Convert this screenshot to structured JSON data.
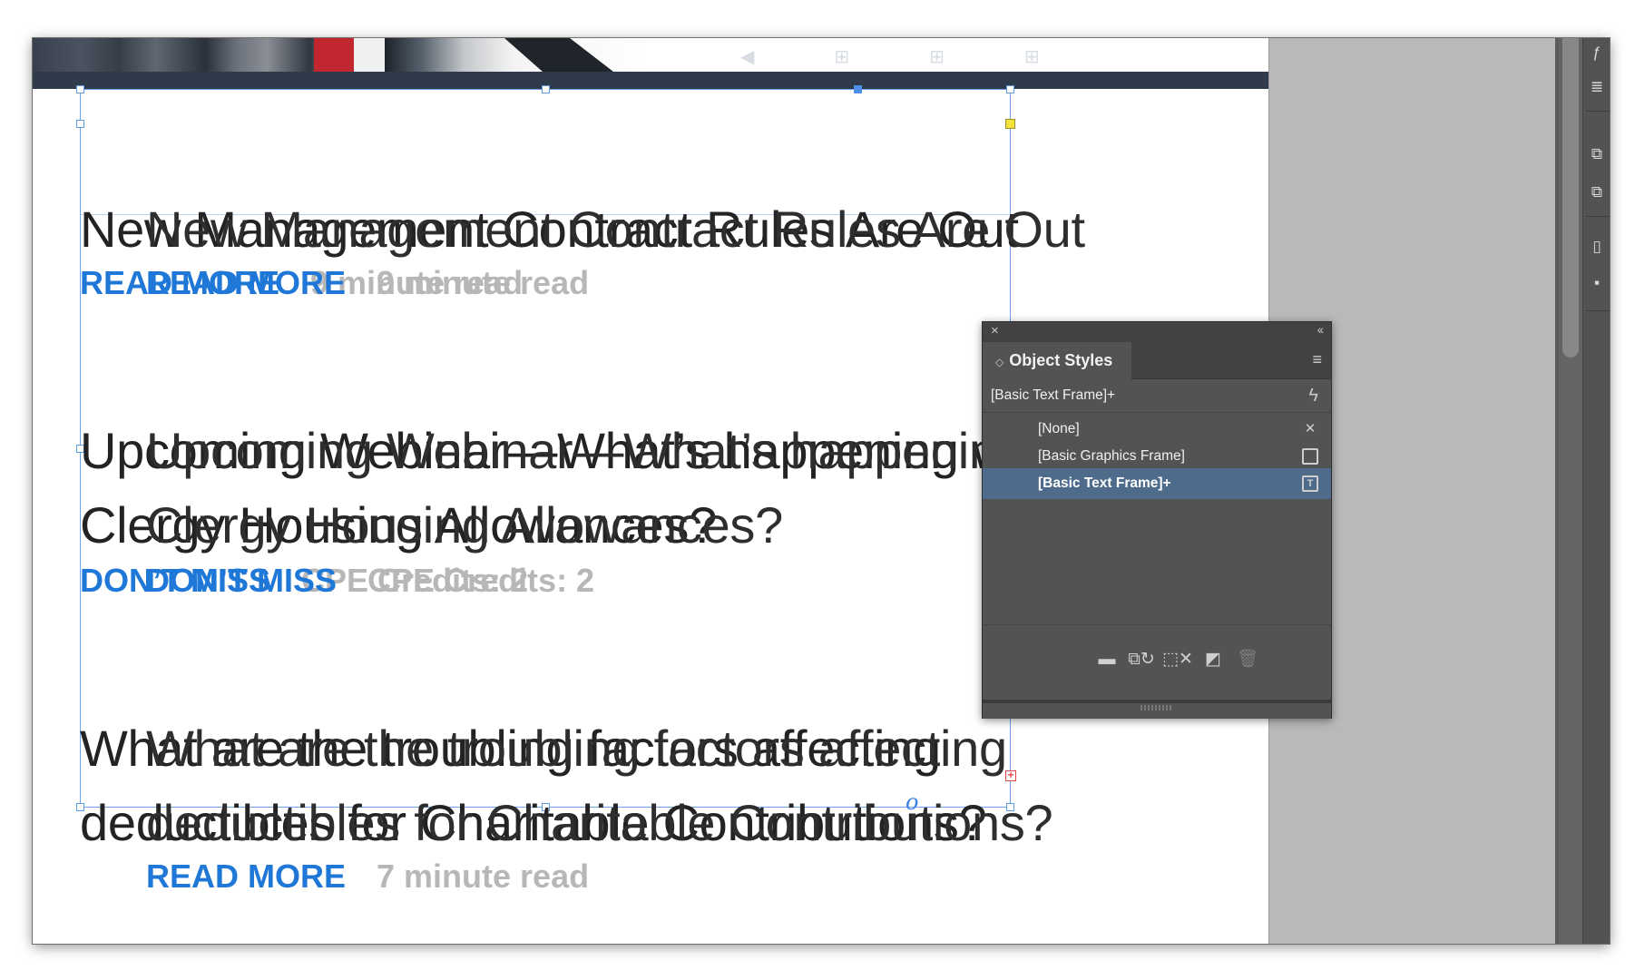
{
  "document": {
    "stories": [
      {
        "headline_lines": [
          "New Management Contract Rules Are Out"
        ],
        "cta": "READ MORE",
        "info": "9 minute read"
      },
      {
        "headline_lines": [
          "Upcoming Webinar—What’s happening with",
          "Clergy Housing Allowances?"
        ],
        "cta": "DON’T MISS",
        "info": "CPE Credits: 2"
      },
      {
        "headline_lines": [
          "What are the troubling factors affecting",
          "deductibles for Charitable Contributions?"
        ],
        "cta": "READ MORE",
        "info": "7 minute read"
      }
    ],
    "overset_marker": "+",
    "thread_marker": "o"
  },
  "object_styles_panel": {
    "close_glyph": "×",
    "collapse_glyph": "‹‹",
    "tab_label": "Object Styles",
    "tab_arrows": "◇",
    "menu_glyph": "≡",
    "current_style": "[Basic Text Frame]+",
    "styles": [
      {
        "name": "[None]",
        "icon": "no-style-icon",
        "selected": false
      },
      {
        "name": "[Basic Graphics Frame]",
        "icon": "graphics-frame-icon",
        "selected": false
      },
      {
        "name": "[Basic Text Frame]+",
        "icon": "text-frame-icon",
        "selected": true
      }
    ],
    "footer_buttons": [
      {
        "name": "new-group-button",
        "icon": "folder-icon"
      },
      {
        "name": "clear-overrides-button",
        "icon": "clear-overrides-icon"
      },
      {
        "name": "clear-attributes-button",
        "icon": "clear-attributes-icon"
      },
      {
        "name": "new-style-button",
        "icon": "new-page-icon"
      },
      {
        "name": "delete-style-button",
        "icon": "trash-icon"
      }
    ]
  },
  "colors": {
    "cta_blue": "#1f78d7",
    "info_gray": "#b7b7b7",
    "selection_blue": "#4f6b8b",
    "frame_blue": "#6aa4ee",
    "header_bar": "#2f3b4b"
  }
}
